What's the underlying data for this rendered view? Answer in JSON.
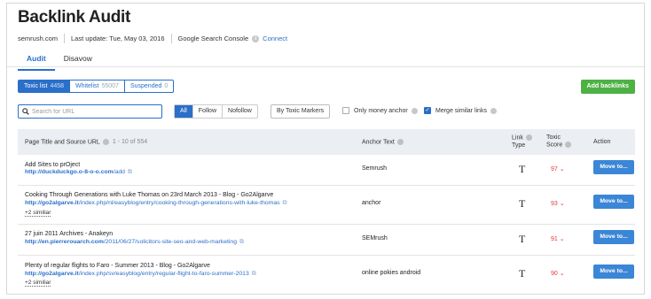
{
  "header": {
    "title": "Backlink Audit",
    "domain": "semrush.com",
    "last_update": "Last update: Tue, May 03, 2016",
    "gsc_label": "Google Search Console",
    "connect_label": "Connect"
  },
  "tabs": [
    {
      "label": "Audit",
      "active": true
    },
    {
      "label": "Disavow",
      "active": false
    }
  ],
  "segments": [
    {
      "label": "Toxic list",
      "count": "4458",
      "active": true
    },
    {
      "label": "Whitelist",
      "count": "55007",
      "active": false
    },
    {
      "label": "Suspended",
      "count": "0",
      "active": false
    }
  ],
  "add_backlinks_label": "Add backlinks",
  "search": {
    "placeholder": "Search for URL",
    "value": ""
  },
  "filters": [
    {
      "label": "All",
      "active": true
    },
    {
      "label": "Follow",
      "active": false
    },
    {
      "label": "Nofollow",
      "active": false
    }
  ],
  "toxic_markers_label": "By Toxic Markers",
  "checkboxes": {
    "money_anchor": {
      "label": "Only money anchor",
      "checked": false
    },
    "merge_similar": {
      "label": "Merge similar links",
      "checked": true
    }
  },
  "table": {
    "col_title": "Page Title and Source URL",
    "col_count": "1 - 10 of 554",
    "col_anchor": "Anchor Text",
    "col_link_type_1": "Link",
    "col_link_type_2": "Type",
    "col_toxic_1": "Toxic",
    "col_toxic_2": "Score",
    "col_action": "Action",
    "rows": [
      {
        "title": "Add Sites to prOject",
        "url_domain": "http://duckduckgo.o-8-o-o.com",
        "url_path": "/add",
        "similar": "",
        "anchor": "Semrush",
        "link_type": "T",
        "score": "97",
        "action": "Move to..."
      },
      {
        "title": "Cooking Through Generations with Luke Thomas on 23rd March 2013 - Blog - Go2Algarve",
        "url_domain": "http://go2algarve.it",
        "url_path": "/index.php/nl/easyblog/entry/cooking-through-generations-with-luke-thomas",
        "similar": "+2 similiar",
        "anchor": "anchor",
        "link_type": "T",
        "score": "93",
        "action": "Move to..."
      },
      {
        "title": "27 juin 2011 Archives - Anakeyn",
        "url_domain": "http://en.pierrerouarch.com",
        "url_path": "/2011/06/27/solicitors-site-seo-and-web-marketing",
        "similar": "",
        "anchor": "SEMrush",
        "link_type": "T",
        "score": "91",
        "action": "Move to..."
      },
      {
        "title": "Plenty of regular flights to Faro - Summer 2013 - Blog - Go2Algarve",
        "url_domain": "http://go2algarve.it",
        "url_path": "/index.php/sv/easyblog/entry/regular-flight-to-faro-summer-2013",
        "similar": "+2 similiar",
        "anchor": "online pokies android",
        "link_type": "T",
        "score": "90",
        "action": "Move to..."
      }
    ]
  },
  "colors": {
    "accent": "#2a6fc9",
    "add_button": "#4db146",
    "toxic": "#e03b3b",
    "move_button": "#3b86d6"
  }
}
